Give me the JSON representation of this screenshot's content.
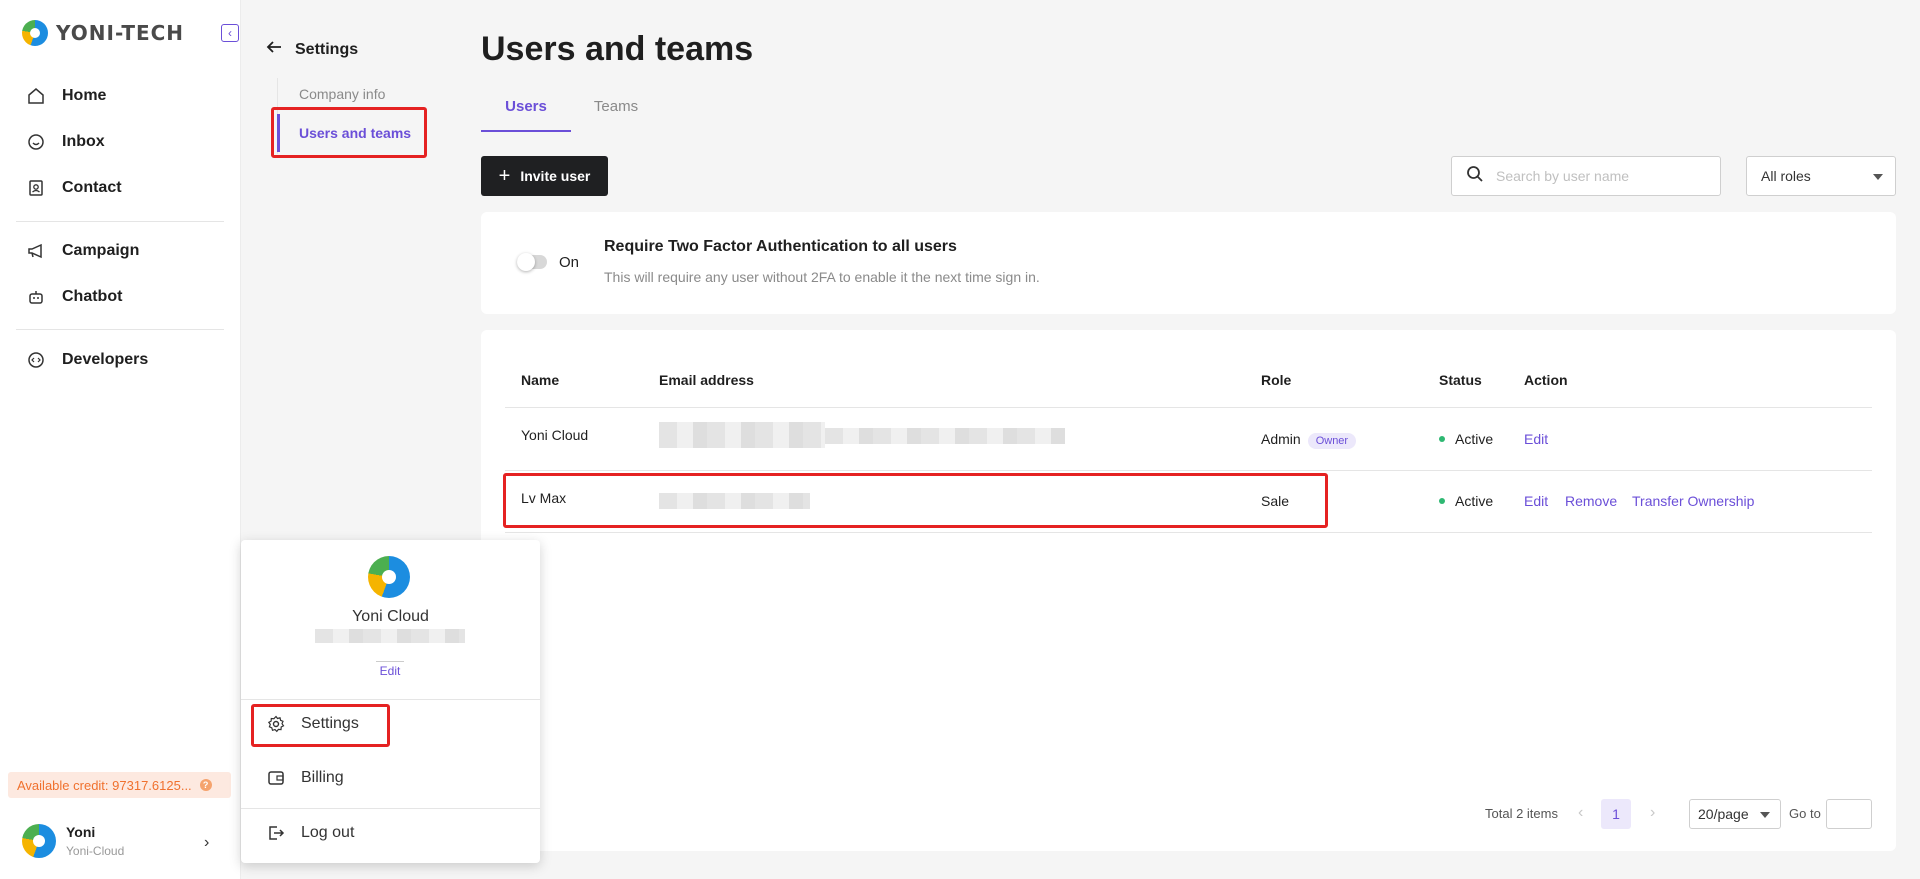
{
  "brand": {
    "name": "YONI-TECH"
  },
  "nav": {
    "items": [
      {
        "label": "Home",
        "icon": "home-icon"
      },
      {
        "label": "Inbox",
        "icon": "inbox-icon"
      },
      {
        "label": "Contact",
        "icon": "contact-icon"
      },
      {
        "label": "Campaign",
        "icon": "megaphone-icon"
      },
      {
        "label": "Chatbot",
        "icon": "robot-icon"
      },
      {
        "label": "Developers",
        "icon": "code-icon"
      }
    ]
  },
  "credit": {
    "text": "Available credit: 97317.6125..."
  },
  "footer_user": {
    "name": "Yoni",
    "org": "Yoni-Cloud"
  },
  "settings_nav": {
    "title": "Settings",
    "items": [
      {
        "label": "Company info"
      },
      {
        "label": "Users and teams"
      }
    ]
  },
  "main": {
    "title": "Users and teams",
    "tabs": [
      {
        "label": "Users"
      },
      {
        "label": "Teams"
      }
    ],
    "invite_label": "Invite user",
    "search": {
      "placeholder": "Search by user name"
    },
    "role_filter": {
      "value": "All roles"
    },
    "tfa": {
      "toggle_label": "On",
      "title": "Require Two Factor Authentication to all users",
      "description": "This will require any user without 2FA to enable it the next time sign in."
    },
    "table": {
      "headers": {
        "name": "Name",
        "email": "Email address",
        "role": "Role",
        "status": "Status",
        "action": "Action"
      },
      "rows": [
        {
          "name": "Yoni Cloud",
          "role": "Admin",
          "badge": "Owner",
          "status": "Active",
          "actions": [
            "Edit"
          ]
        },
        {
          "name": "Lv Max",
          "role": "Sale",
          "status": "Active",
          "actions": [
            "Edit",
            "Remove",
            "Transfer Ownership"
          ]
        }
      ]
    },
    "pagination": {
      "total": "Total 2 items",
      "current_page": "1",
      "page_size": "20/page",
      "goto_label": "Go to"
    }
  },
  "popover": {
    "name": "Yoni Cloud",
    "edit_label": "Edit",
    "items": [
      {
        "label": "Settings",
        "icon": "gear-icon"
      },
      {
        "label": "Billing",
        "icon": "wallet-icon"
      },
      {
        "label": "Log out",
        "icon": "logout-icon"
      }
    ]
  },
  "colors": {
    "accent": "#6b4fd8",
    "highlight": "#e52222",
    "status_active": "#2eb872"
  }
}
